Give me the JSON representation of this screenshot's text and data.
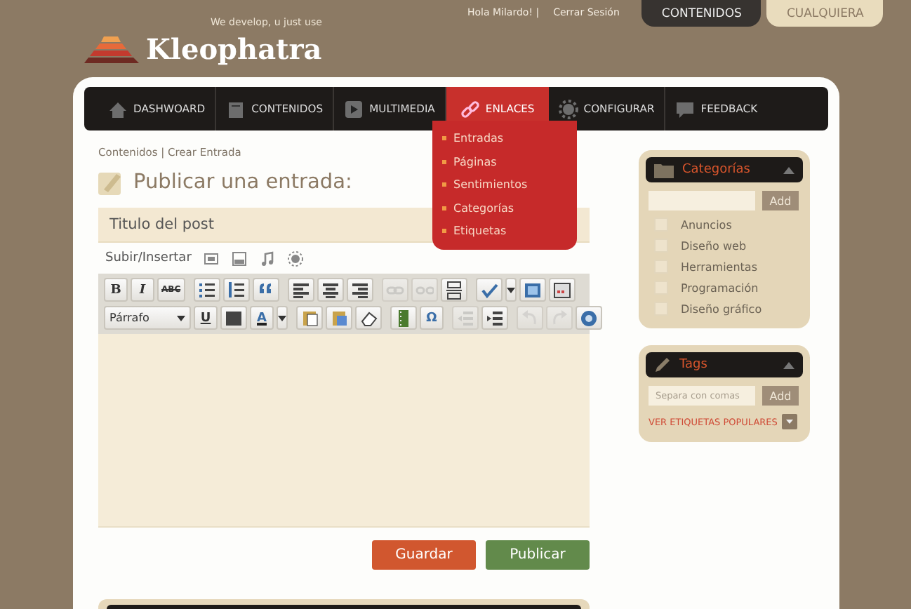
{
  "header": {
    "logo_text": "Kleophatra",
    "tagline": "We develop, u just use",
    "greeting": "Hola Milardo! |",
    "logout": "Cerrar Sesión",
    "tabs": [
      {
        "label": "CONTENIDOS",
        "selected": true
      },
      {
        "label": "CUALQUIERA",
        "selected": false
      }
    ]
  },
  "nav": {
    "items": [
      {
        "kind": "home",
        "label": "DASHWOARD",
        "selected": false
      },
      {
        "kind": "pages",
        "label": "CONTENIDOS",
        "selected": false
      },
      {
        "kind": "media",
        "label": "MULTIMEDIA",
        "selected": false
      },
      {
        "kind": "link",
        "label": "ENLACES",
        "selected": true
      },
      {
        "kind": "gear",
        "label": "CONFIGURAR",
        "selected": false
      },
      {
        "kind": "chat",
        "label": "FEEDBACK",
        "selected": false
      }
    ]
  },
  "dropdown": {
    "items": [
      "Entradas",
      "Páginas",
      "Sentimientos",
      "Categorías",
      "Etiquetas"
    ]
  },
  "breadcrumb": "Contenidos | Crear Entrada",
  "page_title": "Publicar una entrada:",
  "post_title": {
    "value": "Titulo del post"
  },
  "upload": {
    "label": "Subir/Insertar",
    "items": [
      {
        "kind": "image"
      },
      {
        "kind": "video"
      },
      {
        "kind": "audio"
      },
      {
        "kind": "media"
      }
    ]
  },
  "toolbar": {
    "rows": [
      [
        [
          {
            "kind": "bold",
            "label": "B",
            "disabled": false
          },
          {
            "kind": "italic",
            "label": "I",
            "disabled": false
          },
          {
            "kind": "strike",
            "label": "ABC",
            "disabled": false
          }
        ],
        [
          {
            "kind": "ul",
            "disabled": false
          },
          {
            "kind": "ol",
            "disabled": false
          },
          {
            "kind": "quote",
            "disabled": false
          }
        ],
        [
          {
            "kind": "align-left",
            "disabled": false
          },
          {
            "kind": "align-center",
            "disabled": false
          },
          {
            "kind": "align-right",
            "disabled": false
          }
        ],
        [
          {
            "kind": "link",
            "disabled": true
          },
          {
            "kind": "unlink",
            "disabled": true
          },
          {
            "kind": "more",
            "disabled": false
          }
        ],
        [
          {
            "kind": "spell",
            "disabled": false
          },
          {
            "kind": "fullscreen",
            "disabled": false
          },
          {
            "kind": "kitchen",
            "disabled": false
          }
        ]
      ],
      [
        [
          {
            "kind": "format",
            "label": "Párrafo",
            "disabled": false
          },
          {
            "kind": "underline",
            "label": "U",
            "disabled": false
          },
          {
            "kind": "justify",
            "disabled": false
          },
          {
            "kind": "color",
            "label": "A",
            "disabled": false
          }
        ],
        [
          {
            "kind": "paste-text",
            "disabled": false
          },
          {
            "kind": "paste-word",
            "disabled": false
          },
          {
            "kind": "eraser",
            "disabled": false
          }
        ],
        [
          {
            "kind": "film",
            "disabled": false
          },
          {
            "kind": "charmap",
            "label": "Ω",
            "disabled": false
          }
        ],
        [
          {
            "kind": "outdent",
            "disabled": true
          },
          {
            "kind": "indent",
            "disabled": false
          }
        ],
        [
          {
            "kind": "undo",
            "disabled": true
          },
          {
            "kind": "redo",
            "disabled": true
          },
          {
            "kind": "help",
            "disabled": false
          }
        ]
      ]
    ]
  },
  "actions": [
    {
      "kind": "save",
      "label": "Guardar"
    },
    {
      "kind": "publish",
      "label": "Publicar"
    }
  ],
  "categories": {
    "title": "Categorías",
    "add": "Add",
    "items": [
      {
        "label": "Anuncios",
        "checked": false
      },
      {
        "label": "Diseño web",
        "checked": false
      },
      {
        "label": "Herramientas",
        "checked": false
      },
      {
        "label": "Programación",
        "checked": false
      },
      {
        "label": "Diseño gráfico",
        "checked": false
      }
    ]
  },
  "tags": {
    "title": "Tags",
    "placeholder": "Separa con comas",
    "add": "Add",
    "popular": "VER ETIQUETAS POPULARES"
  }
}
